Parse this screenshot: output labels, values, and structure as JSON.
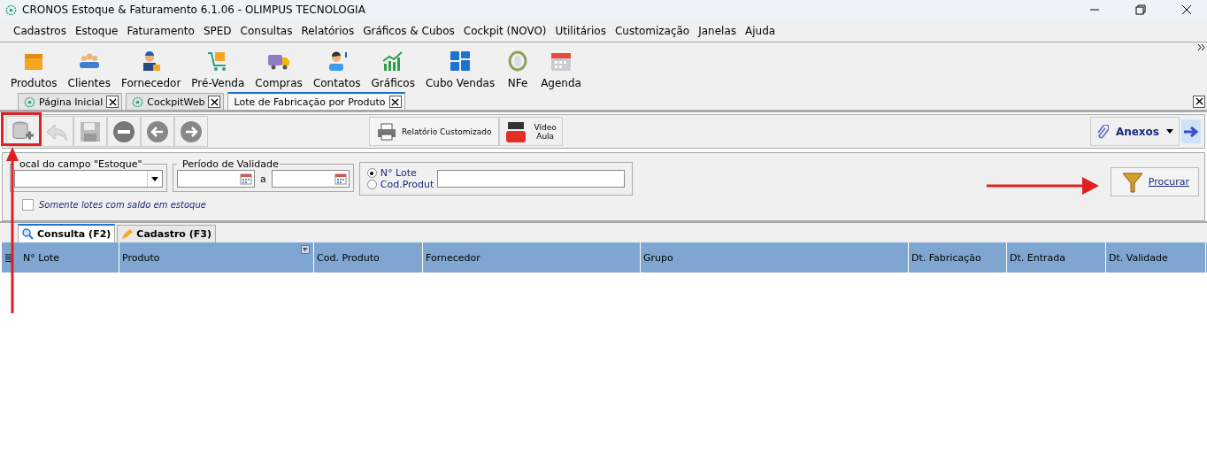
{
  "window": {
    "title": "CRONOS Estoque & Faturamento 6.1.06 - OLIMPUS TECNOLOGIA"
  },
  "menu": [
    "Cadastros",
    "Estoque",
    "Faturamento",
    "SPED",
    "Consultas",
    "Relatórios",
    "Gráficos & Cubos",
    "Cockpit (NOVO)",
    "Utilitários",
    "Customização",
    "Janelas",
    "Ajuda"
  ],
  "toolbar": [
    "Produtos",
    "Clientes",
    "Fornecedor",
    "Pré-Venda",
    "Compras",
    "Contatos",
    "Gráficos",
    "Cubo Vendas",
    "NFe",
    "Agenda"
  ],
  "doc_tabs": [
    {
      "label": "Página Inicial",
      "selected": false
    },
    {
      "label": "CockpitWeb",
      "selected": false
    },
    {
      "label": "Lote de Fabricação por Produto",
      "selected": true
    }
  ],
  "actions": {
    "report": "Relatório Customizado",
    "video": [
      "Vídeo",
      "Aula"
    ],
    "attachments": "Anexos"
  },
  "filters": {
    "local_legend": "ocal do campo \"Estoque\"",
    "period_legend": "Período de Validade",
    "period_sep": "a",
    "options": [
      {
        "label": "N° Lote",
        "selected": true
      },
      {
        "label": "Cod.Produt",
        "selected": false
      }
    ],
    "only_with_balance": {
      "label": "Somente lotes com saldo em estoque",
      "checked": false
    },
    "search_button": "Procurar"
  },
  "sub_tabs": [
    {
      "label": "Consulta (F2)",
      "selected": true
    },
    {
      "label": "Cadastro (F3)",
      "selected": false
    }
  ],
  "columns": [
    "N° Lote",
    "Produto",
    "Cod. Produto",
    "Fornecedor",
    "Grupo",
    "Dt. Fabricação",
    "Dt. Entrada",
    "Dt. Validade"
  ]
}
